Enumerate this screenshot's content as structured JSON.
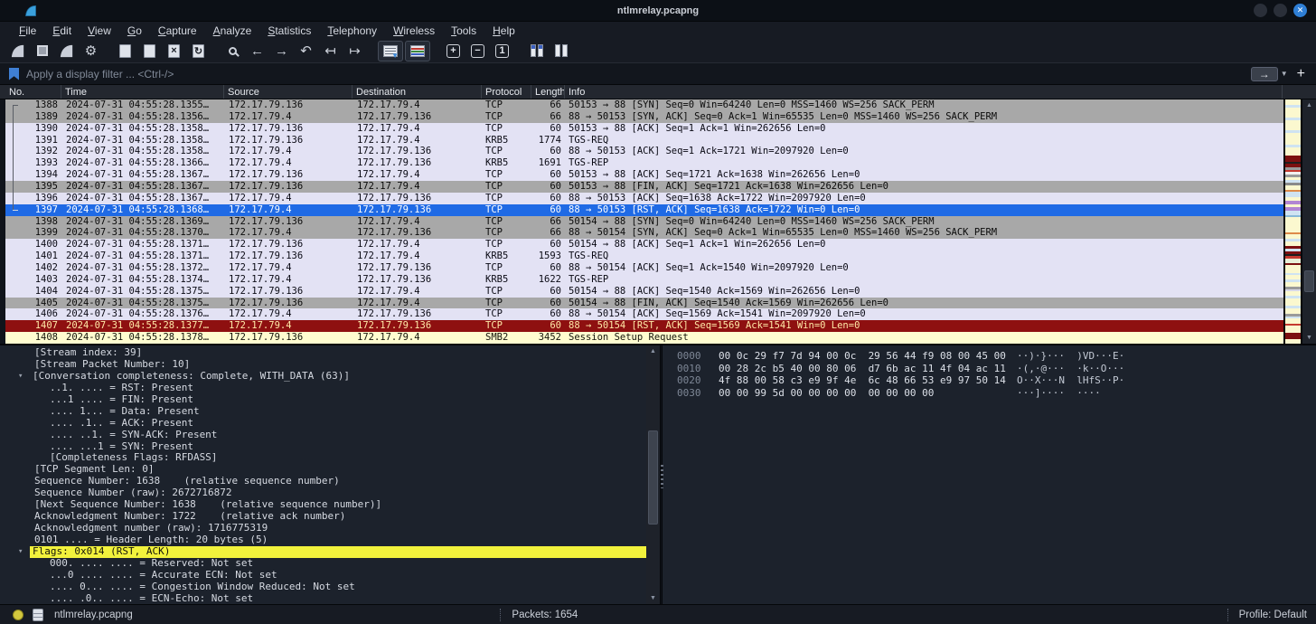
{
  "window": {
    "title": "ntlmrelay.pcapng"
  },
  "menu": {
    "items": [
      "File",
      "Edit",
      "View",
      "Go",
      "Capture",
      "Analyze",
      "Statistics",
      "Telephony",
      "Wireless",
      "Tools",
      "Help"
    ]
  },
  "toolbar": {
    "icons": [
      {
        "name": "start-capture-icon",
        "type": "fin"
      },
      {
        "name": "stop-capture-icon",
        "type": "stop"
      },
      {
        "name": "restart-capture-icon",
        "type": "fin"
      },
      {
        "name": "capture-options-icon",
        "type": "glyph",
        "glyph": "⚙"
      },
      {
        "name": "open-file-icon",
        "type": "doc-open",
        "gap": true
      },
      {
        "name": "save-file-icon",
        "type": "doc-save"
      },
      {
        "name": "close-file-icon",
        "type": "doc-close",
        "glyph": "×"
      },
      {
        "name": "reload-file-icon",
        "type": "doc-reload",
        "glyph": "↻"
      },
      {
        "name": "find-packet-icon",
        "type": "find",
        "gap": true
      },
      {
        "name": "go-back-icon",
        "type": "glyph",
        "glyph": "←"
      },
      {
        "name": "go-forward-icon",
        "type": "glyph",
        "glyph": "→"
      },
      {
        "name": "go-to-packet-icon",
        "type": "glyph",
        "glyph": "↶"
      },
      {
        "name": "previous-packet-icon",
        "type": "glyph",
        "glyph": "↤"
      },
      {
        "name": "next-packet-icon",
        "type": "glyph",
        "glyph": "↦"
      },
      {
        "name": "auto-scroll-icon",
        "type": "autoscroll",
        "gap": true,
        "boxed": true
      },
      {
        "name": "colorize-icon",
        "type": "colorize",
        "boxed": true
      },
      {
        "name": "zoom-in-icon",
        "type": "sq",
        "glyph": "+",
        "gap": true
      },
      {
        "name": "zoom-out-icon",
        "type": "sq",
        "glyph": "−"
      },
      {
        "name": "normal-size-icon",
        "type": "sq",
        "glyph": "1"
      },
      {
        "name": "resize-columns-icon",
        "type": "cols",
        "gap": true
      },
      {
        "name": "number-columns-icon",
        "type": "cols2"
      }
    ]
  },
  "filter": {
    "placeholder": "Apply a display filter ... <Ctrl-/>"
  },
  "packet_list": {
    "columns": [
      "No.",
      "Time",
      "Source",
      "Destination",
      "Protocol",
      "Length",
      "Info"
    ],
    "rows": [
      {
        "no": "1388",
        "time": "2024-07-31 04:55:28.1355…",
        "src": "172.17.79.136",
        "dst": "172.17.79.4",
        "proto": "TCP",
        "len": "66",
        "info": "50153 → 88 [SYN] Seq=0 Win=64240 Len=0 MSS=1460 WS=256 SACK_PERM",
        "variant": "gray",
        "bracket": "start"
      },
      {
        "no": "1389",
        "time": "2024-07-31 04:55:28.1356…",
        "src": "172.17.79.4",
        "dst": "172.17.79.136",
        "proto": "TCP",
        "len": "66",
        "info": "88 → 50153 [SYN, ACK] Seq=0 Ack=1 Win=65535 Len=0 MSS=1460 WS=256 SACK_PERM",
        "variant": "gray",
        "bracket": "mid"
      },
      {
        "no": "1390",
        "time": "2024-07-31 04:55:28.1358…",
        "src": "172.17.79.136",
        "dst": "172.17.79.4",
        "proto": "TCP",
        "len": "60",
        "info": "50153 → 88 [ACK] Seq=1 Ack=1 Win=262656 Len=0",
        "variant": "lav",
        "bracket": "mid"
      },
      {
        "no": "1391",
        "time": "2024-07-31 04:55:28.1358…",
        "src": "172.17.79.136",
        "dst": "172.17.79.4",
        "proto": "KRB5",
        "len": "1774",
        "info": "TGS-REQ",
        "variant": "lav",
        "bracket": "mid"
      },
      {
        "no": "1392",
        "time": "2024-07-31 04:55:28.1358…",
        "src": "172.17.79.4",
        "dst": "172.17.79.136",
        "proto": "TCP",
        "len": "60",
        "info": "88 → 50153 [ACK] Seq=1 Ack=1721 Win=2097920 Len=0",
        "variant": "lav",
        "bracket": "mid"
      },
      {
        "no": "1393",
        "time": "2024-07-31 04:55:28.1366…",
        "src": "172.17.79.4",
        "dst": "172.17.79.136",
        "proto": "KRB5",
        "len": "1691",
        "info": "TGS-REP",
        "variant": "lav",
        "bracket": "mid"
      },
      {
        "no": "1394",
        "time": "2024-07-31 04:55:28.1367…",
        "src": "172.17.79.136",
        "dst": "172.17.79.4",
        "proto": "TCP",
        "len": "60",
        "info": "50153 → 88 [ACK] Seq=1721 Ack=1638 Win=262656 Len=0",
        "variant": "lav",
        "bracket": "mid"
      },
      {
        "no": "1395",
        "time": "2024-07-31 04:55:28.1367…",
        "src": "172.17.79.136",
        "dst": "172.17.79.4",
        "proto": "TCP",
        "len": "60",
        "info": "50153 → 88 [FIN, ACK] Seq=1721 Ack=1638 Win=262656 Len=0",
        "variant": "gray",
        "bracket": "mid"
      },
      {
        "no": "1396",
        "time": "2024-07-31 04:55:28.1367…",
        "src": "172.17.79.4",
        "dst": "172.17.79.136",
        "proto": "TCP",
        "len": "60",
        "info": "88 → 50153 [ACK] Seq=1638 Ack=1722 Win=2097920 Len=0",
        "variant": "lav",
        "bracket": "mid"
      },
      {
        "no": "1397",
        "time": "2024-07-31 04:55:28.1368…",
        "src": "172.17.79.4",
        "dst": "172.17.79.136",
        "proto": "TCP",
        "len": "60",
        "info": "88 → 50153 [RST, ACK] Seq=1638 Ack=1722 Win=0 Len=0",
        "variant": "sel",
        "bracket": "end"
      },
      {
        "no": "1398",
        "time": "2024-07-31 04:55:28.1369…",
        "src": "172.17.79.136",
        "dst": "172.17.79.4",
        "proto": "TCP",
        "len": "66",
        "info": "50154 → 88 [SYN] Seq=0 Win=64240 Len=0 MSS=1460 WS=256 SACK_PERM",
        "variant": "gray",
        "bracket": null
      },
      {
        "no": "1399",
        "time": "2024-07-31 04:55:28.1370…",
        "src": "172.17.79.4",
        "dst": "172.17.79.136",
        "proto": "TCP",
        "len": "66",
        "info": "88 → 50154 [SYN, ACK] Seq=0 Ack=1 Win=65535 Len=0 MSS=1460 WS=256 SACK_PERM",
        "variant": "gray",
        "bracket": null
      },
      {
        "no": "1400",
        "time": "2024-07-31 04:55:28.1371…",
        "src": "172.17.79.136",
        "dst": "172.17.79.4",
        "proto": "TCP",
        "len": "60",
        "info": "50154 → 88 [ACK] Seq=1 Ack=1 Win=262656 Len=0",
        "variant": "lav",
        "bracket": null
      },
      {
        "no": "1401",
        "time": "2024-07-31 04:55:28.1371…",
        "src": "172.17.79.136",
        "dst": "172.17.79.4",
        "proto": "KRB5",
        "len": "1593",
        "info": "TGS-REQ",
        "variant": "lav",
        "bracket": null
      },
      {
        "no": "1402",
        "time": "2024-07-31 04:55:28.1372…",
        "src": "172.17.79.4",
        "dst": "172.17.79.136",
        "proto": "TCP",
        "len": "60",
        "info": "88 → 50154 [ACK] Seq=1 Ack=1540 Win=2097920 Len=0",
        "variant": "lav",
        "bracket": null
      },
      {
        "no": "1403",
        "time": "2024-07-31 04:55:28.1374…",
        "src": "172.17.79.4",
        "dst": "172.17.79.136",
        "proto": "KRB5",
        "len": "1622",
        "info": "TGS-REP",
        "variant": "lav",
        "bracket": null
      },
      {
        "no": "1404",
        "time": "2024-07-31 04:55:28.1375…",
        "src": "172.17.79.136",
        "dst": "172.17.79.4",
        "proto": "TCP",
        "len": "60",
        "info": "50154 → 88 [ACK] Seq=1540 Ack=1569 Win=262656 Len=0",
        "variant": "lav",
        "bracket": null
      },
      {
        "no": "1405",
        "time": "2024-07-31 04:55:28.1375…",
        "src": "172.17.79.136",
        "dst": "172.17.79.4",
        "proto": "TCP",
        "len": "60",
        "info": "50154 → 88 [FIN, ACK] Seq=1540 Ack=1569 Win=262656 Len=0",
        "variant": "gray",
        "bracket": null
      },
      {
        "no": "1406",
        "time": "2024-07-31 04:55:28.1376…",
        "src": "172.17.79.4",
        "dst": "172.17.79.136",
        "proto": "TCP",
        "len": "60",
        "info": "88 → 50154 [ACK] Seq=1569 Ack=1541 Win=2097920 Len=0",
        "variant": "lav",
        "bracket": null
      },
      {
        "no": "1407",
        "time": "2024-07-31 04:55:28.1377…",
        "src": "172.17.79.4",
        "dst": "172.17.79.136",
        "proto": "TCP",
        "len": "60",
        "info": "88 → 50154 [RST, ACK] Seq=1569 Ack=1541 Win=0 Len=0",
        "variant": "bad",
        "bracket": null
      },
      {
        "no": "1408",
        "time": "2024-07-31 04:55:28.1378…",
        "src": "172.17.79.136",
        "dst": "172.17.79.4",
        "proto": "SMB2",
        "len": "3452",
        "info": "Session Setup Request",
        "variant": "smb",
        "bracket": null
      }
    ]
  },
  "details": {
    "lines": [
      {
        "t": "[Stream index: 39]",
        "i": 2
      },
      {
        "t": "[Stream Packet Number: 10]",
        "i": 2
      },
      {
        "t": "[Conversation completeness: Complete, WITH_DATA (63)]",
        "i": 1,
        "exp": true
      },
      {
        "t": "..1. .... = RST: Present",
        "i": 3
      },
      {
        "t": "...1 .... = FIN: Present",
        "i": 3
      },
      {
        "t": ".... 1... = Data: Present",
        "i": 3
      },
      {
        "t": ".... .1.. = ACK: Present",
        "i": 3
      },
      {
        "t": ".... ..1. = SYN-ACK: Present",
        "i": 3
      },
      {
        "t": ".... ...1 = SYN: Present",
        "i": 3
      },
      {
        "t": "[Completeness Flags: RFDASS]",
        "i": 3
      },
      {
        "t": "[TCP Segment Len: 0]",
        "i": 2
      },
      {
        "t": "Sequence Number: 1638    (relative sequence number)",
        "i": 2
      },
      {
        "t": "Sequence Number (raw): 2672716872",
        "i": 2
      },
      {
        "t": "[Next Sequence Number: 1638    (relative sequence number)]",
        "i": 2
      },
      {
        "t": "Acknowledgment Number: 1722    (relative ack number)",
        "i": 2
      },
      {
        "t": "Acknowledgment number (raw): 1716775319",
        "i": 2
      },
      {
        "t": "0101 .... = Header Length: 20 bytes (5)",
        "i": 2
      },
      {
        "t": "Flags: 0x014 (RST, ACK)",
        "i": 1,
        "exp": true,
        "hl": true
      },
      {
        "t": "000. .... .... = Reserved: Not set",
        "i": 3
      },
      {
        "t": "...0 .... .... = Accurate ECN: Not set",
        "i": 3
      },
      {
        "t": ".... 0... .... = Congestion Window Reduced: Not set",
        "i": 3
      },
      {
        "t": ".... .0.. .... = ECN-Echo: Not set",
        "i": 3
      }
    ]
  },
  "hexdump": {
    "rows": [
      {
        "offset": "0000",
        "hex": "00 0c 29 f7 7d 94 00 0c  29 56 44 f9 08 00 45 00",
        "ascii": "··)·}···  )VD···E·"
      },
      {
        "offset": "0010",
        "hex": "00 28 2c b5 40 00 80 06  d7 6b ac 11 4f 04 ac 11",
        "ascii": "·(,·@···  ·k··O···"
      },
      {
        "offset": "0020",
        "hex": "4f 88 00 58 c3 e9 9f 4e  6c 48 66 53 e9 97 50 14",
        "ascii": "O··X···N  lHfS··P·"
      },
      {
        "offset": "0030",
        "hex": "00 00 99 5d 00 00 00 00  00 00 00 00",
        "ascii": "···]····  ····"
      }
    ]
  },
  "minimap": {
    "stripes": [
      [
        2,
        "#fbf8cf"
      ],
      [
        0.8,
        "#cfe3f2"
      ],
      [
        3.5,
        "#fbf8cf"
      ],
      [
        0.8,
        "#cfe3f2"
      ],
      [
        3.5,
        "#fbf8cf"
      ],
      [
        0.8,
        "#cfe3f2"
      ],
      [
        4,
        "#fbf8cf"
      ],
      [
        0.8,
        "#cfe3f2"
      ],
      [
        3,
        "#fbf8cf"
      ],
      [
        2.2,
        "#7c1010"
      ],
      [
        0.6,
        "#1e1e1e"
      ],
      [
        1.2,
        "#7c1010"
      ],
      [
        0.8,
        "#9a9a9a"
      ],
      [
        0.8,
        "#c5392f"
      ],
      [
        0.8,
        "#f0f0f0"
      ],
      [
        0.8,
        "#9a9a9a"
      ],
      [
        1.2,
        "#fbf8cf"
      ],
      [
        0.8,
        "#cfe3f2"
      ],
      [
        0.8,
        "#8a8a8a"
      ],
      [
        1.6,
        "#fbf8cf"
      ],
      [
        0.8,
        "#dd8a4a"
      ],
      [
        1.6,
        "#cfe3f2"
      ],
      [
        1.2,
        "#fbf8cf"
      ],
      [
        1.4,
        "#b286d3"
      ],
      [
        0.8,
        "#fbf8cf"
      ],
      [
        1.2,
        "#b286d3"
      ],
      [
        1.6,
        "#cfe3f2"
      ],
      [
        0.8,
        "#88b8d8"
      ],
      [
        5,
        "#fbf8cf"
      ],
      [
        0.8,
        "#dd8a4a"
      ],
      [
        1.6,
        "#fbf8cf"
      ],
      [
        0.8,
        "#cfe3f2"
      ],
      [
        1.6,
        "#fbf8cf"
      ],
      [
        1,
        "#7c1010"
      ],
      [
        0.8,
        "#cfe3f2"
      ],
      [
        1,
        "#7c1010"
      ],
      [
        0.6,
        "#1e1e1e"
      ],
      [
        0.8,
        "#c5392f"
      ],
      [
        1.6,
        "#e8f0d8"
      ],
      [
        0.8,
        "#7c1010"
      ],
      [
        2.5,
        "#fbf8cf"
      ],
      [
        0.8,
        "#cfe3f2"
      ],
      [
        1.6,
        "#fbf8cf"
      ],
      [
        0.8,
        "#cfe3f2"
      ],
      [
        1.6,
        "#fbf8cf"
      ],
      [
        0.8,
        "#9a9a9a"
      ],
      [
        0.8,
        "#d8d8e8"
      ],
      [
        1.6,
        "#fbf8cf"
      ],
      [
        0.8,
        "#cfe3f2"
      ],
      [
        2.5,
        "#fbf8cf"
      ],
      [
        0.8,
        "#cfe3f2"
      ],
      [
        2,
        "#fbf8cf"
      ],
      [
        0.8,
        "#9a9a9a"
      ],
      [
        0.8,
        "#cfe3f2"
      ],
      [
        1.6,
        "#fbf8cf"
      ],
      [
        0.8,
        "#c5392f"
      ],
      [
        2.5,
        "#fbf8cf"
      ],
      [
        2,
        "#7c1010"
      ],
      [
        1.6,
        "#fbf8cf"
      ]
    ]
  },
  "status": {
    "filename": "ntlmrelay.pcapng",
    "packets": "Packets: 1654",
    "profile": "Profile: Default"
  },
  "colors": {
    "selected_row": "#1f6ae5",
    "bad_tcp_bg": "#8e1010",
    "smb_row_bg": "#fffdd0",
    "gray_row_bg": "#a8a8a8",
    "lavender_row_bg": "#e3e2f4",
    "detail_highlight": "#f2f23c",
    "accent_blue": "#2f7fd6"
  }
}
